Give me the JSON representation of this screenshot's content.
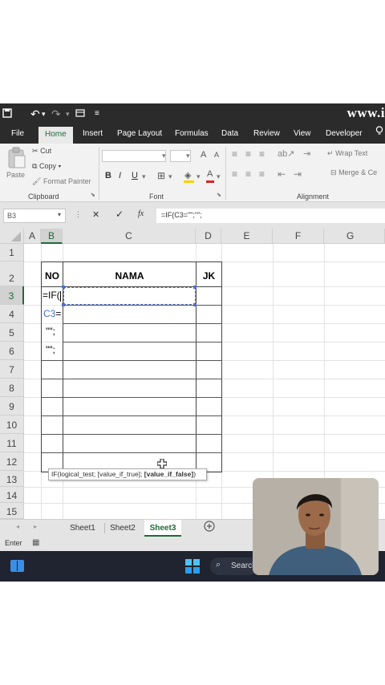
{
  "quick_access": {
    "watermark": "www.i"
  },
  "tabs": [
    "File",
    "Home",
    "Insert",
    "Page Layout",
    "Formulas",
    "Data",
    "Review",
    "View",
    "Developer"
  ],
  "active_tab": "Home",
  "clipboard": {
    "paste": "Paste",
    "cut": "Cut",
    "copy": "Copy",
    "format_painter": "Format Painter",
    "group": "Clipboard"
  },
  "font": {
    "group": "Font",
    "bold": "B",
    "italic": "I",
    "underline": "U",
    "grow": "A",
    "shrink": "A",
    "color": "A"
  },
  "alignment": {
    "wrap_text": "Wrap Text",
    "merge": "Merge & Ce",
    "group": "Alignment"
  },
  "formula_bar": {
    "name_box": "B3",
    "cancel": "✕",
    "enter": "✓",
    "fx": "fx",
    "content": "=IF(C3=\"\";\"\";"
  },
  "columns": [
    "A",
    "B",
    "C",
    "D",
    "E",
    "F",
    "G"
  ],
  "rows": [
    "1",
    "2",
    "3",
    "4",
    "5",
    "6",
    "7",
    "8",
    "9",
    "10",
    "11",
    "12",
    "13",
    "14",
    "15"
  ],
  "table": {
    "headers": [
      "NO",
      "NAMA",
      "JK"
    ]
  },
  "editing": {
    "line1": "=IF(",
    "line2a": "C3",
    "line2b": "=",
    "line3": "\"\";",
    "line4": "\"\";"
  },
  "tooltip": {
    "text": "IF(logical_test; [value_if_true]; ",
    "bold": "[value_if_false]",
    "close": ")"
  },
  "sheets": [
    "Sheet1",
    "Sheet2",
    "Sheet3"
  ],
  "active_sheet": "Sheet3",
  "status": {
    "mode": "Enter"
  },
  "taskbar": {
    "search": "Search"
  }
}
